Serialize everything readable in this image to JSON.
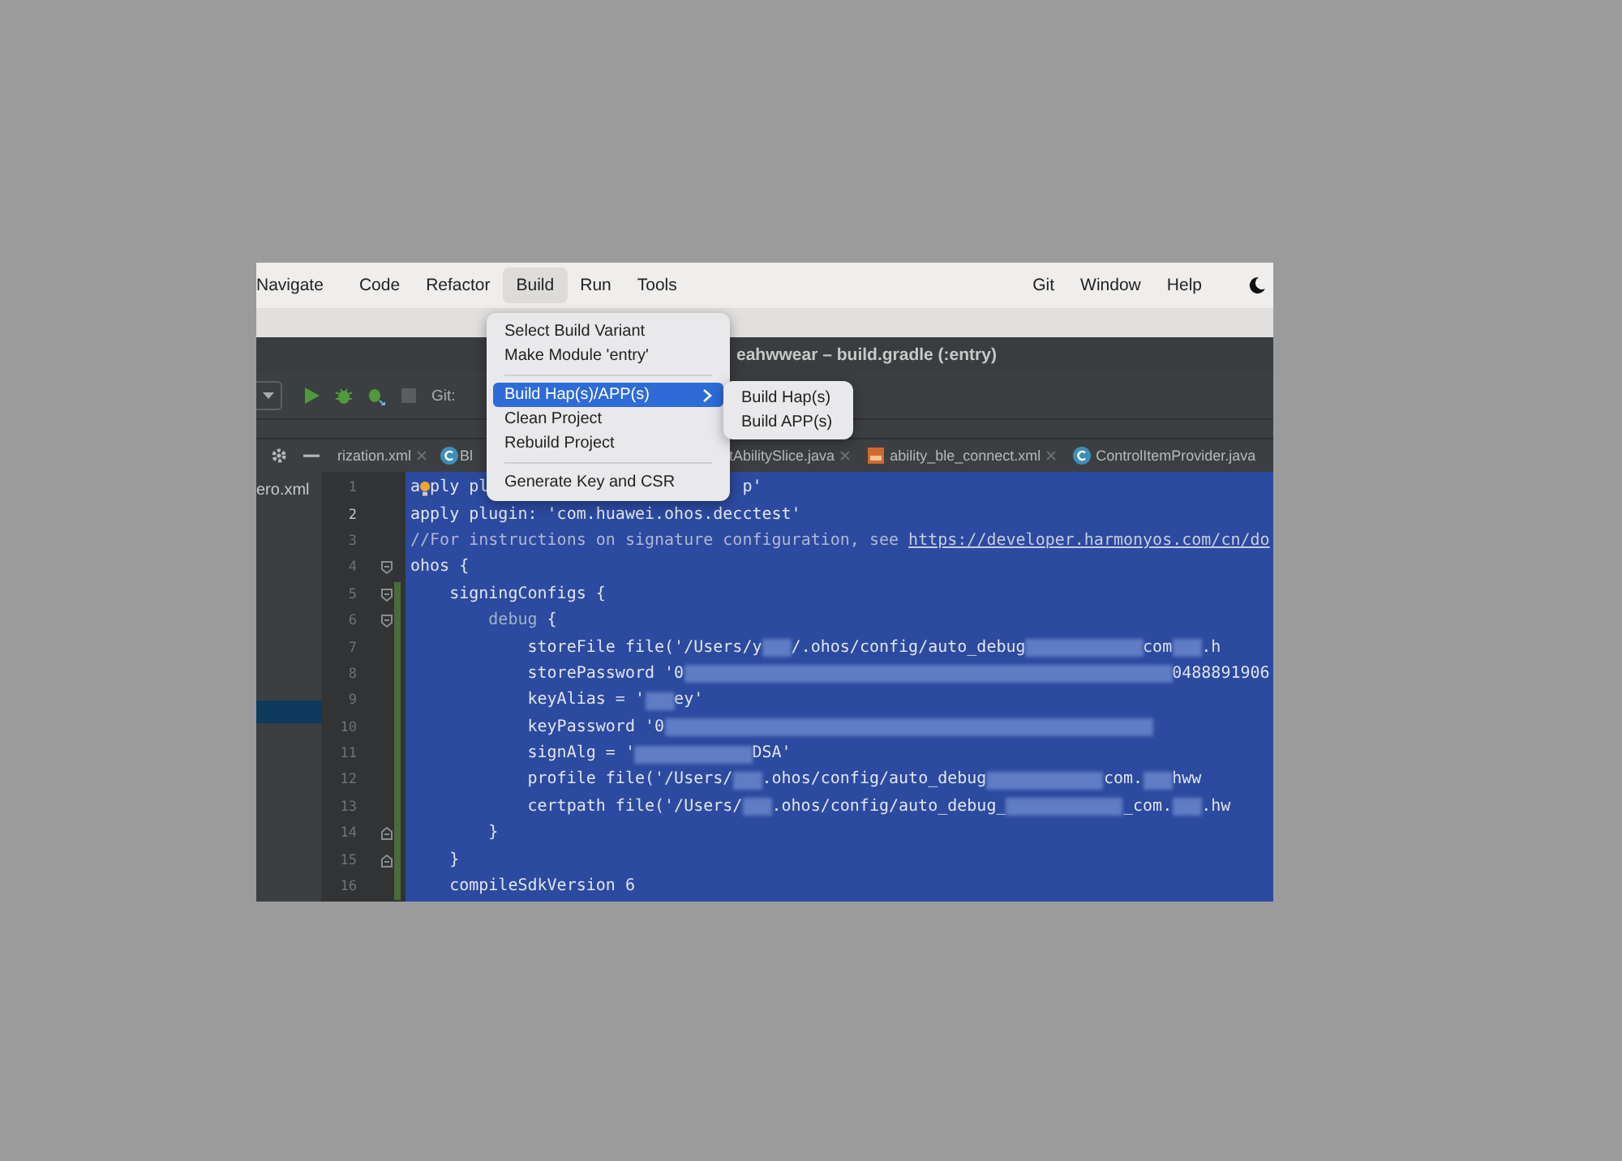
{
  "menu_bar": {
    "items": [
      {
        "label": "Navigate",
        "selected": false
      },
      {
        "label": "Code",
        "selected": false
      },
      {
        "label": "Refactor",
        "selected": false
      },
      {
        "label": "Build",
        "selected": true
      },
      {
        "label": "Run",
        "selected": false
      },
      {
        "label": "Tools",
        "selected": false
      }
    ],
    "right_items": [
      {
        "label": "Git"
      },
      {
        "label": "Window"
      },
      {
        "label": "Help"
      }
    ]
  },
  "window_title": "eahwwear – build.gradle (:entry)",
  "toolbar": {
    "vcs_label": "Git:"
  },
  "editor_tabs": [
    {
      "label": "rization.xml",
      "kind": "plain",
      "close": true
    },
    {
      "label": "Bl",
      "kind": "class",
      "close": false
    },
    {
      "label": "tAbilitySlice.java",
      "kind": "plain",
      "close": true
    },
    {
      "label": "ability_ble_connect.xml",
      "kind": "layout",
      "close": true
    },
    {
      "label": "ControlItemProvider.java",
      "kind": "class",
      "close": false
    }
  ],
  "project_tree": {
    "rows": [
      {
        "label": "ero.xml",
        "selected": false
      },
      {
        "selected": false
      },
      {
        "selected": false
      },
      {
        "selected": false
      },
      {
        "selected": false
      },
      {
        "selected": false
      },
      {
        "selected": false
      },
      {
        "selected": false
      },
      {
        "selected": true
      }
    ]
  },
  "editor": {
    "lines": [
      {
        "number": "1",
        "current": false,
        "changed": false,
        "fold_start": false,
        "fold_end": false,
        "segments": [
          {
            "kind": "code",
            "text": "a"
          },
          {
            "kind": "bulb"
          },
          {
            "kind": "code",
            "text": "ply pl"
          },
          {
            "kind": "covered"
          },
          {
            "kind": "code",
            "text": "p'"
          }
        ]
      },
      {
        "number": "2",
        "current": true,
        "changed": false,
        "fold_start": false,
        "fold_end": false,
        "segments": [
          {
            "kind": "code",
            "text": "apply plugin: 'com.huawei.ohos.decctest'"
          }
        ]
      },
      {
        "number": "3",
        "current": false,
        "changed": false,
        "fold_start": false,
        "fold_end": false,
        "segments": [
          {
            "kind": "comment",
            "text": "//For instructions on signature configuration, see "
          },
          {
            "kind": "link",
            "text": "https://developer.harmonyos.com/cn/do"
          }
        ]
      },
      {
        "number": "4",
        "current": false,
        "changed": false,
        "fold_start": true,
        "fold_end": false,
        "segments": [
          {
            "kind": "code",
            "text": "ohos {"
          }
        ]
      },
      {
        "number": "5",
        "current": false,
        "changed": true,
        "fold_start": true,
        "fold_end": false,
        "segments": [
          {
            "kind": "code",
            "text": "    signingConfigs {"
          }
        ]
      },
      {
        "number": "6",
        "current": false,
        "changed": true,
        "fold_start": true,
        "fold_end": false,
        "segments": [
          {
            "kind": "keyword",
            "text": "        debug"
          },
          {
            "kind": "code",
            "text": " {"
          }
        ]
      },
      {
        "number": "7",
        "current": false,
        "changed": true,
        "fold_start": false,
        "fold_end": false,
        "segments": [
          {
            "kind": "code",
            "text": "            storeFile file('/Users/y"
          },
          {
            "kind": "blur-short"
          },
          {
            "kind": "code",
            "text": "/.ohos/config/auto_debug"
          },
          {
            "kind": "blur-medium"
          },
          {
            "kind": "code",
            "text": "com"
          },
          {
            "kind": "blur-short"
          },
          {
            "kind": "code",
            "text": ".h"
          }
        ]
      },
      {
        "number": "8",
        "current": false,
        "changed": true,
        "fold_start": false,
        "fold_end": false,
        "segments": [
          {
            "kind": "code",
            "text": "            storePassword '0"
          },
          {
            "kind": "blur-long"
          },
          {
            "kind": "code",
            "text": "0488891906"
          }
        ]
      },
      {
        "number": "9",
        "current": false,
        "changed": true,
        "fold_start": false,
        "fold_end": false,
        "segments": [
          {
            "kind": "code",
            "text": "            keyAlias = '"
          },
          {
            "kind": "blur-short"
          },
          {
            "kind": "code",
            "text": "ey'"
          }
        ]
      },
      {
        "number": "10",
        "current": false,
        "changed": true,
        "fold_start": false,
        "fold_end": false,
        "segments": [
          {
            "kind": "code",
            "text": "            keyPassword '0"
          },
          {
            "kind": "blur-long"
          }
        ]
      },
      {
        "number": "11",
        "current": false,
        "changed": true,
        "fold_start": false,
        "fold_end": false,
        "segments": [
          {
            "kind": "code",
            "text": "            signAlg = '"
          },
          {
            "kind": "blur-medium"
          },
          {
            "kind": "code",
            "text": "DSA'"
          }
        ]
      },
      {
        "number": "12",
        "current": false,
        "changed": true,
        "fold_start": false,
        "fold_end": false,
        "segments": [
          {
            "kind": "code",
            "text": "            profile file('/Users/"
          },
          {
            "kind": "blur-short"
          },
          {
            "kind": "code",
            "text": ".ohos/config/auto_debug"
          },
          {
            "kind": "blur-medium"
          },
          {
            "kind": "code",
            "text": "com."
          },
          {
            "kind": "blur-short"
          },
          {
            "kind": "code",
            "text": "hww"
          }
        ]
      },
      {
        "number": "13",
        "current": false,
        "changed": true,
        "fold_start": false,
        "fold_end": false,
        "segments": [
          {
            "kind": "code",
            "text": "            certpath file('/Users/"
          },
          {
            "kind": "blur-short"
          },
          {
            "kind": "code",
            "text": ".ohos/config/auto_debug_"
          },
          {
            "kind": "blur-medium"
          },
          {
            "kind": "code",
            "text": "_com."
          },
          {
            "kind": "blur-short"
          },
          {
            "kind": "code",
            "text": ".hw"
          }
        ]
      },
      {
        "number": "14",
        "current": false,
        "changed": true,
        "fold_start": false,
        "fold_end": true,
        "segments": [
          {
            "kind": "code",
            "text": "        }"
          }
        ]
      },
      {
        "number": "15",
        "current": false,
        "changed": true,
        "fold_start": false,
        "fold_end": true,
        "segments": [
          {
            "kind": "code",
            "text": "    }"
          }
        ]
      },
      {
        "number": "16",
        "current": false,
        "changed": true,
        "fold_start": false,
        "fold_end": false,
        "segments": [
          {
            "kind": "code",
            "text": "    compileSdkVersion 6"
          }
        ]
      }
    ]
  },
  "build_menu": {
    "items": [
      {
        "kind": "item",
        "label": "Select Build Variant",
        "selected": false
      },
      {
        "kind": "item",
        "label": "Make Module 'entry'",
        "selected": false
      },
      {
        "kind": "separator"
      },
      {
        "kind": "submenu",
        "label": "Build Hap(s)/APP(s)",
        "selected": true
      },
      {
        "kind": "item",
        "label": "Clean Project",
        "selected": false
      },
      {
        "kind": "item",
        "label": "Rebuild Project",
        "selected": false
      },
      {
        "kind": "separator"
      },
      {
        "kind": "item",
        "label": "Generate Key and CSR",
        "selected": false
      }
    ]
  },
  "submenu": {
    "items": [
      {
        "label": "Build Hap(s)"
      },
      {
        "label": "Build APP(s)"
      }
    ]
  }
}
